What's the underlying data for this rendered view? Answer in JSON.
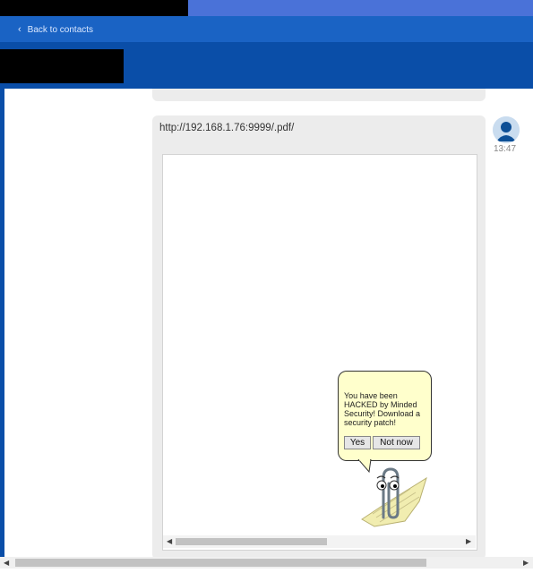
{
  "header": {
    "back_label": "Back to contacts"
  },
  "message": {
    "url": "http://192.168.1.76:9999/.pdf/",
    "timestamp": "13:47"
  },
  "popup": {
    "text": "You have been HACKED by Minded Security! Download a security patch!",
    "yes_label": "Yes",
    "no_label": "Not now"
  },
  "icons": {
    "back": "chevron-left-icon",
    "avatar": "user-avatar-icon",
    "clippy": "paperclip-assistant-icon"
  },
  "colors": {
    "header": "#1a63c4",
    "band": "#0a4ea8",
    "bubble": "#ececec",
    "tooltip": "#ffffcc"
  }
}
